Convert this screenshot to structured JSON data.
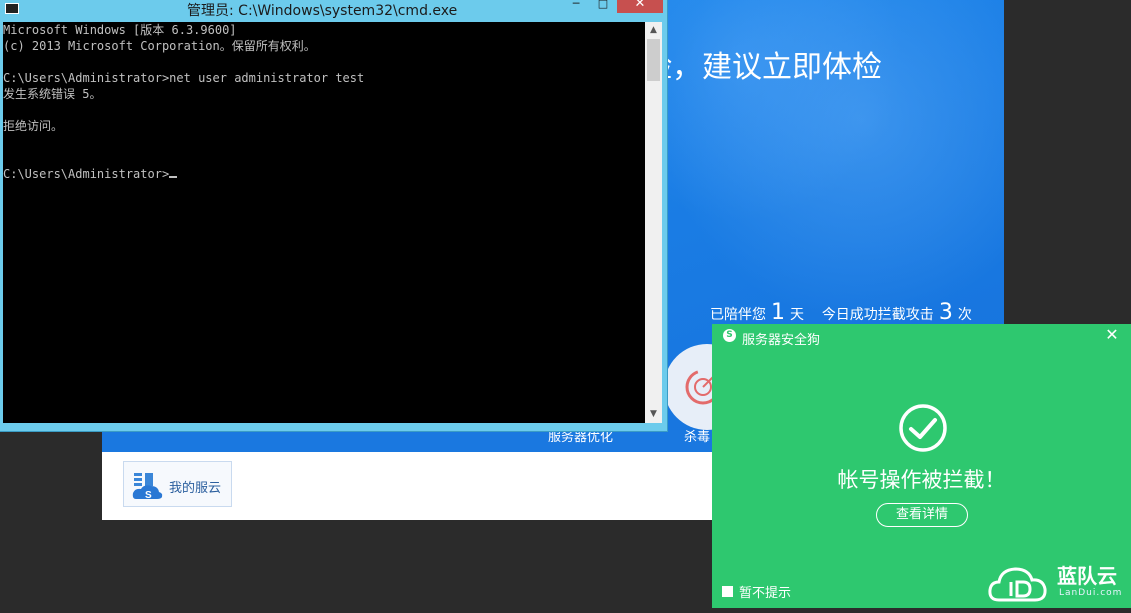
{
  "cmd": {
    "title": "管理员: C:\\Windows\\system32\\cmd.exe",
    "buttons": {
      "minimize": "─",
      "maximize": "□",
      "close": "✕"
    },
    "lines": {
      "l1": "Microsoft Windows [版本 6.3.9600]",
      "l2": "(c) 2013 Microsoft Corporation。保留所有权利。",
      "l3": "C:\\Users\\Administrator>net user administrator test",
      "l4": "发生系统错误 5。",
      "l5": "拒绝访问。",
      "l6": "C:\\Users\\Administrator>"
    }
  },
  "app": {
    "headline": "险，建议立即体检",
    "stats": {
      "prefix": "已陪伴您",
      "days": "1",
      "days_unit": "天",
      "middle": "今日成功拦截攻击",
      "attacks": "3",
      "attacks_unit": "次"
    },
    "nav": {
      "optimize": "服务器优化",
      "virus": "杀毒"
    },
    "my_cloud": "我的服云"
  },
  "toast": {
    "title": "服务器安全狗",
    "message": "帐号操作被拦截！",
    "details_button": "查看详情",
    "no_remind": "暂不提示",
    "close": "✕"
  },
  "watermark": {
    "brand": "蓝队云",
    "sub": "LanDui.com"
  },
  "colors": {
    "toast_green": "#2ec86f",
    "app_blue": "#1b7fe6",
    "cmd_frame": "#6ccbec"
  }
}
